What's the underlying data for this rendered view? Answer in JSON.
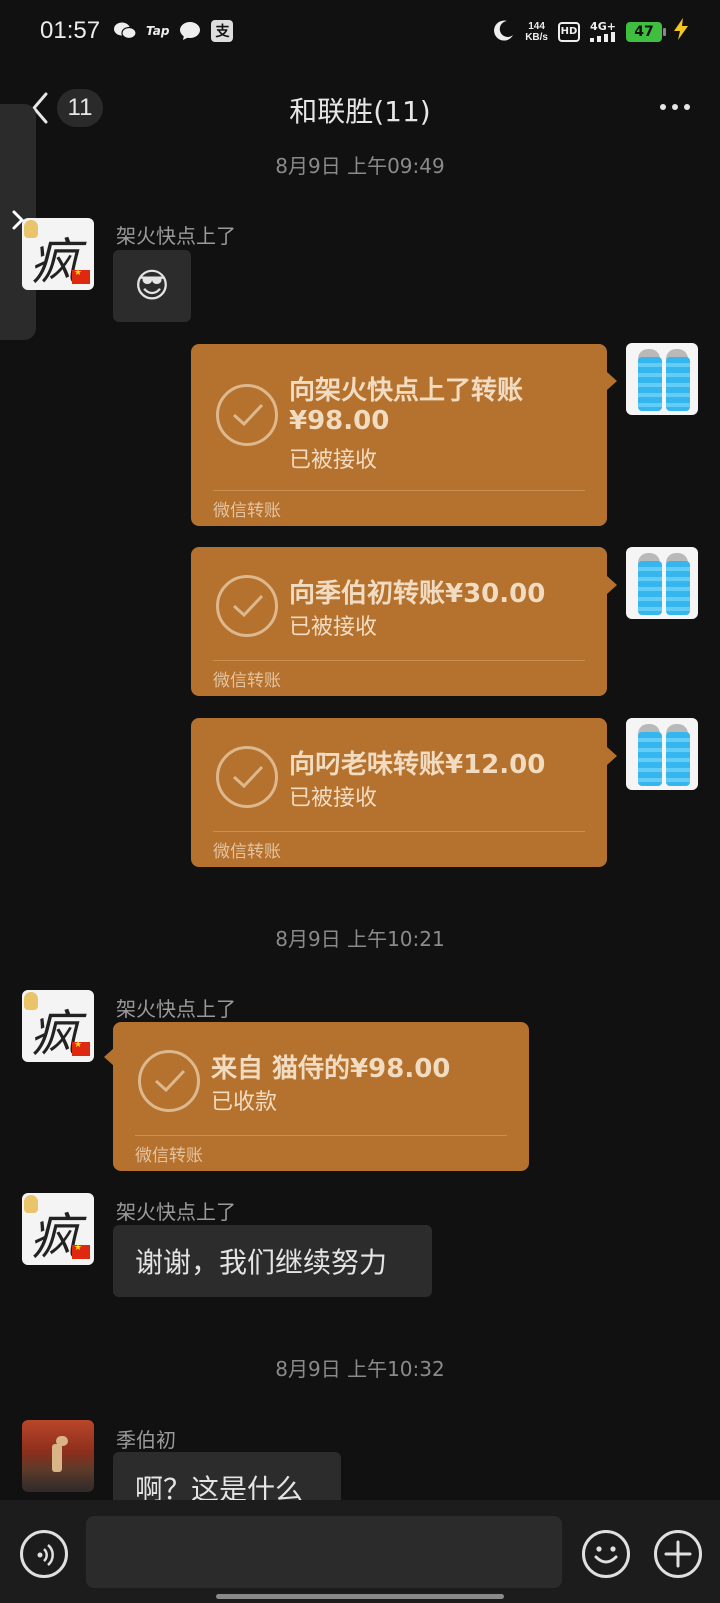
{
  "status_bar": {
    "time": "01:57",
    "tap_label": "Tap",
    "alipay_label": "支",
    "speed_value": "144",
    "speed_unit": "KB/s",
    "hd_label": "HD",
    "network_label": "4G+",
    "battery_level": "47",
    "battery_color": "#3fbe3f"
  },
  "header": {
    "unread_count": "11",
    "title": "和联胜(11)"
  },
  "messages": {
    "ts1": "8月9日 上午09:49",
    "m1_sender": "架火快点上了",
    "m1_emoji": "😎",
    "tr1": {
      "title": "向架火快点上了转账",
      "amount": "¥98.00",
      "status": "已被接收",
      "footer": "微信转账"
    },
    "tr2": {
      "title": "向季伯初转账¥30.00",
      "status": "已被接收",
      "footer": "微信转账"
    },
    "tr3": {
      "title": "向叼老味转账¥12.00",
      "status": "已被接收",
      "footer": "微信转账"
    },
    "ts2": "8月9日 上午10:21",
    "m5_sender": "架火快点上了",
    "tr4": {
      "title": "来自    猫侍的¥98.00",
      "status": "已收款",
      "footer": "微信转账"
    },
    "m6_sender": "架火快点上了",
    "m6_text": "谢谢，我们继续努力",
    "ts3": "8月9日 上午10:32",
    "m7_sender": "季伯初",
    "m7_text": "啊？这是什么"
  },
  "colors": {
    "transfer_bg": "#b5712e",
    "background": "#111111",
    "bubble_gray": "#2c2c2c"
  },
  "icons": [
    "back-arrow-icon",
    "more-dots-icon",
    "drawer-chevron-icon",
    "check-circle-icon",
    "voice-icon",
    "emoji-icon",
    "plus-icon"
  ]
}
